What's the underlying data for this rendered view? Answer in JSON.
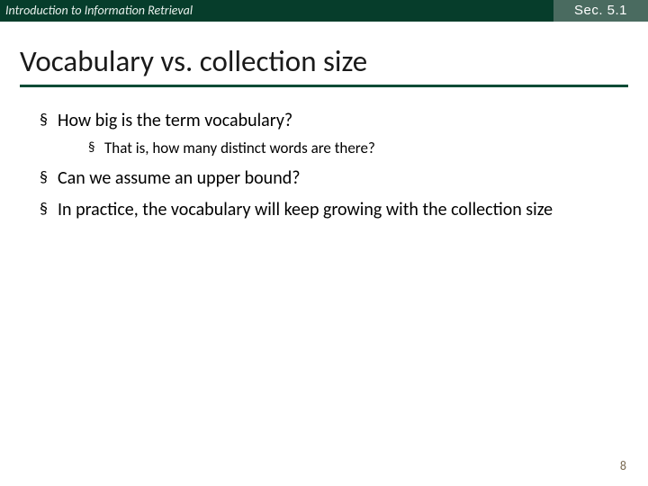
{
  "header": {
    "left": "Introduction to Information Retrieval",
    "right": "Sec. 5.1"
  },
  "title": "Vocabulary vs. collection size",
  "bullets": {
    "b1": "How big is the term vocabulary?",
    "b1_1": "That is, how many distinct words are there?",
    "b2": "Can we assume an upper bound?",
    "b3": "In practice, the vocabulary will keep growing with the collection size"
  },
  "page_number": "8"
}
